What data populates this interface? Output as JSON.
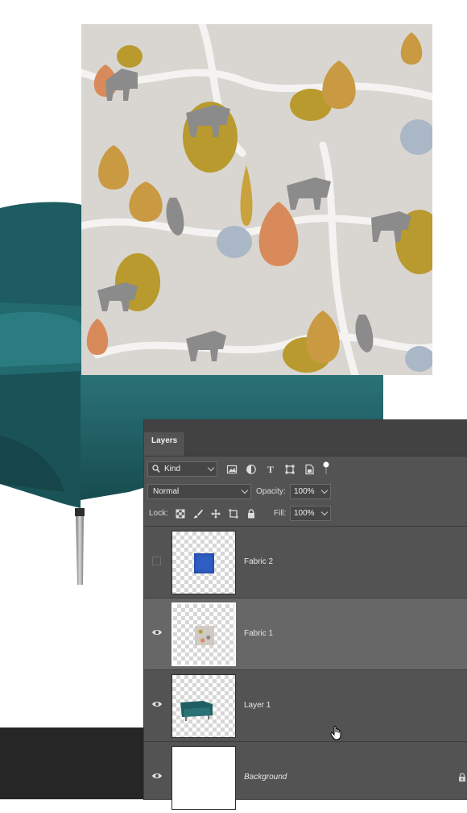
{
  "panel": {
    "tab_label": "Layers",
    "filter": {
      "kind_label": "Kind"
    },
    "blend_mode": "Normal",
    "opacity_label": "Opacity:",
    "opacity_value": "100%",
    "lock_label": "Lock:",
    "fill_label": "Fill:",
    "fill_value": "100%"
  },
  "layers": [
    {
      "name": "Fabric 2",
      "visible": false,
      "selected": false,
      "thumb": "blue-fabric-swatch"
    },
    {
      "name": "Fabric 1",
      "visible": true,
      "selected": true,
      "thumb": "patterned-fabric-swatch"
    },
    {
      "name": "Layer 1",
      "visible": true,
      "selected": false,
      "thumb": "teal-sofa"
    },
    {
      "name": "Background",
      "visible": true,
      "selected": false,
      "thumb": "white",
      "locked": true
    }
  ],
  "colors": {
    "sofa_teal": "#1f5f63",
    "fabric_bg": "#d8d4cf",
    "panel_bg": "#535353",
    "selected_row": "#676767",
    "swatch_blue": "#2f5fc4"
  }
}
